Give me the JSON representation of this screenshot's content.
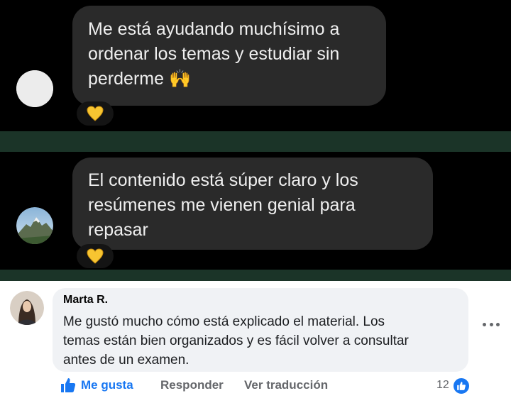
{
  "chat": {
    "messages": [
      {
        "lines": [
          "Me está ayudando muchísimo a",
          "ordenar los temas y estudiar sin",
          "perderme"
        ],
        "emoji": "🙌",
        "reaction": "yellow-heart-icon"
      },
      {
        "lines": [
          "El contenido está súper claro y los",
          "resúmenes me vienen genial para",
          "repasar"
        ],
        "reaction": "yellow-heart-icon"
      }
    ]
  },
  "comment": {
    "author": "Marta R.",
    "text_lines": [
      "Me gustó mucho cómo está explicado el material. Los",
      "temas están bien organizados y es fácil volver a consultar",
      "antes de un examen."
    ],
    "actions": {
      "like": "Me gusta",
      "reply": "Responder",
      "translate": "Ver traducción"
    },
    "like_count": "12"
  },
  "colors": {
    "chat_bg": "#000000",
    "bubble": "#2a2a2a",
    "fb_blue": "#1877f2",
    "muted": "#65676b"
  }
}
